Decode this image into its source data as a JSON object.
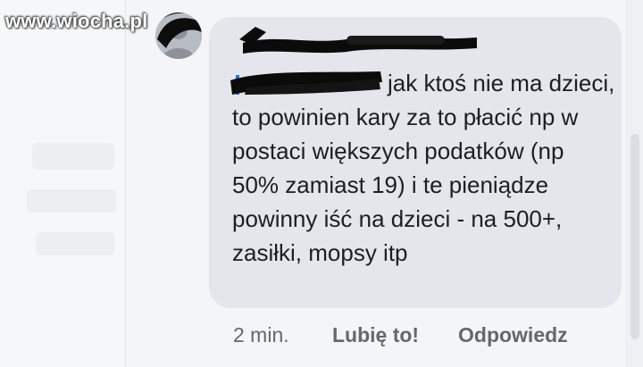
{
  "watermark": "www.wiocha.pl",
  "comment": {
    "text": "jak ktoś nie ma dzieci, to powinien kary za to płacić np w postaci większych podatków (np 50% zamiast 19) i te pieniądze powinny iść na dzieci - na 500+, zasiłki, mopsy itp"
  },
  "actions": {
    "time": "2 min.",
    "like_label": "Lubię to!",
    "reply_label": "Odpowiedz"
  },
  "icons": {
    "avatar": "profile-avatar-icon"
  },
  "colors": {
    "bubble": "#e4e6eb",
    "text": "#1c1e21",
    "meta": "#65676b",
    "mention": "#1877f2"
  }
}
